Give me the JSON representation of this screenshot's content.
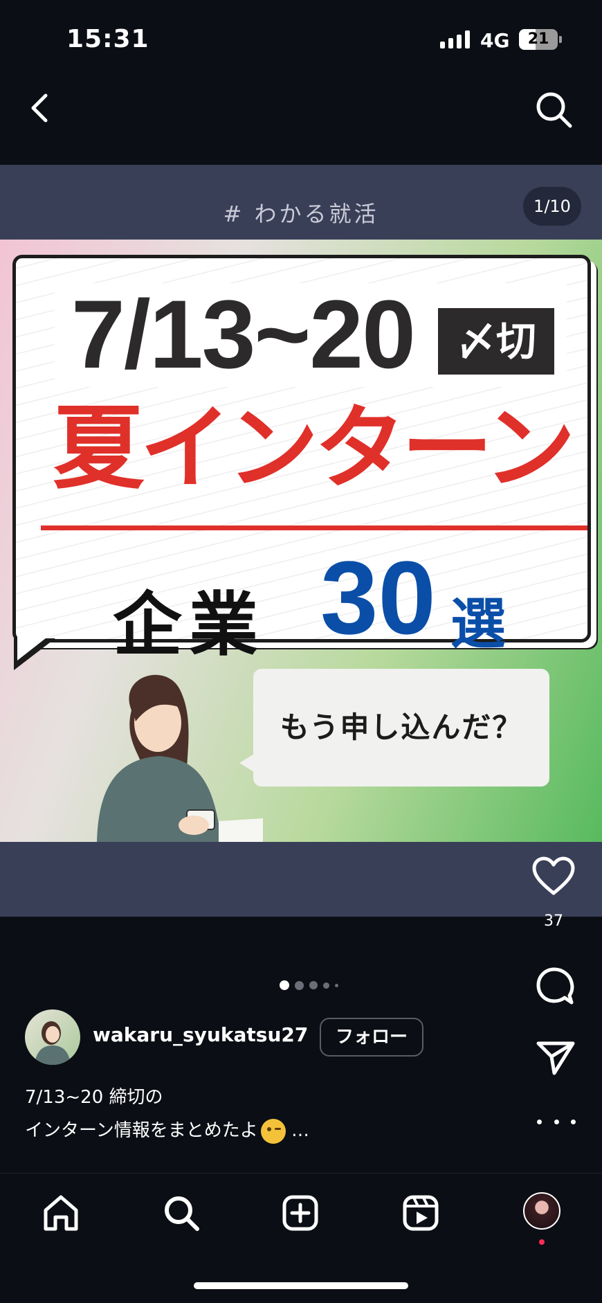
{
  "status": {
    "time": "15:31",
    "network": "4G",
    "battery": "21"
  },
  "post": {
    "tag": "# わかる就活",
    "counter": "1/10",
    "image": {
      "date": "7/13~20",
      "deadline": "〆切",
      "headline": "夏インターン",
      "line3_word": "企業",
      "line3_number": "30",
      "line3_suffix": "選",
      "speech": "もう申し込んだ？"
    },
    "likes": "37",
    "slide_count": 5,
    "current_slide": 1
  },
  "author": {
    "username": "wakaru_syukatsu27",
    "follow_label": "フォロー"
  },
  "caption": {
    "line1": "7/13~20 締切の",
    "line2": "インターン情報をまとめたよ",
    "more": "…"
  },
  "colors": {
    "headline_red": "#e0302a",
    "number_blue": "#0a4ea8",
    "background": "#0b0e14"
  },
  "icons": {
    "back": "chevron-left-icon",
    "search": "search-icon",
    "like": "heart-icon",
    "comment": "comment-icon",
    "share": "paper-plane-icon",
    "more": "more-icon",
    "home": "home-icon",
    "explore": "search-icon",
    "create": "plus-square-icon",
    "reels": "reels-icon"
  }
}
